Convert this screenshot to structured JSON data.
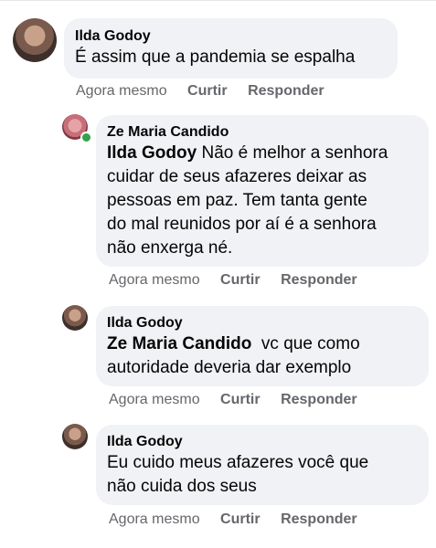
{
  "comments": [
    {
      "author": "Ilda Godoy",
      "text": "É assim que a pandemia se espalha",
      "mention": "",
      "time": "Agora mesmo",
      "like_label": "Curtir",
      "reply_label": "Responder"
    },
    {
      "author": "Ze Maria Candido",
      "mention": "Ilda Godoy",
      "text_line1": " Não é melhor a senhora",
      "text_rest": [
        "cuidar de seus afazeres deixar as",
        "pessoas em paz. Tem tanta gente",
        "do mal reunidos por aí é a senhora",
        "não enxerga né."
      ],
      "time": "Agora mesmo",
      "like_label": "Curtir",
      "reply_label": "Responder",
      "online": true
    },
    {
      "author": "Ilda Godoy",
      "mention": "Ze Maria Candido",
      "text_line1": "  vc que como",
      "text_rest": [
        "autoridade deveria dar exemplo"
      ],
      "time": "Agora mesmo",
      "like_label": "Curtir",
      "reply_label": "Responder"
    },
    {
      "author": "Ilda Godoy",
      "text_lines": [
        "Eu cuido meus afazeres você que",
        "não cuida dos seus"
      ],
      "time": "Agora mesmo",
      "like_label": "Curtir",
      "reply_label": "Responder"
    }
  ],
  "colors": {
    "bubble": "#f0f2f5",
    "meta_text": "#65676b",
    "online": "#31a24c"
  },
  "icons": {
    "avatar_ilda": "user-avatar-photo",
    "avatar_ze": "user-avatar-photo"
  }
}
